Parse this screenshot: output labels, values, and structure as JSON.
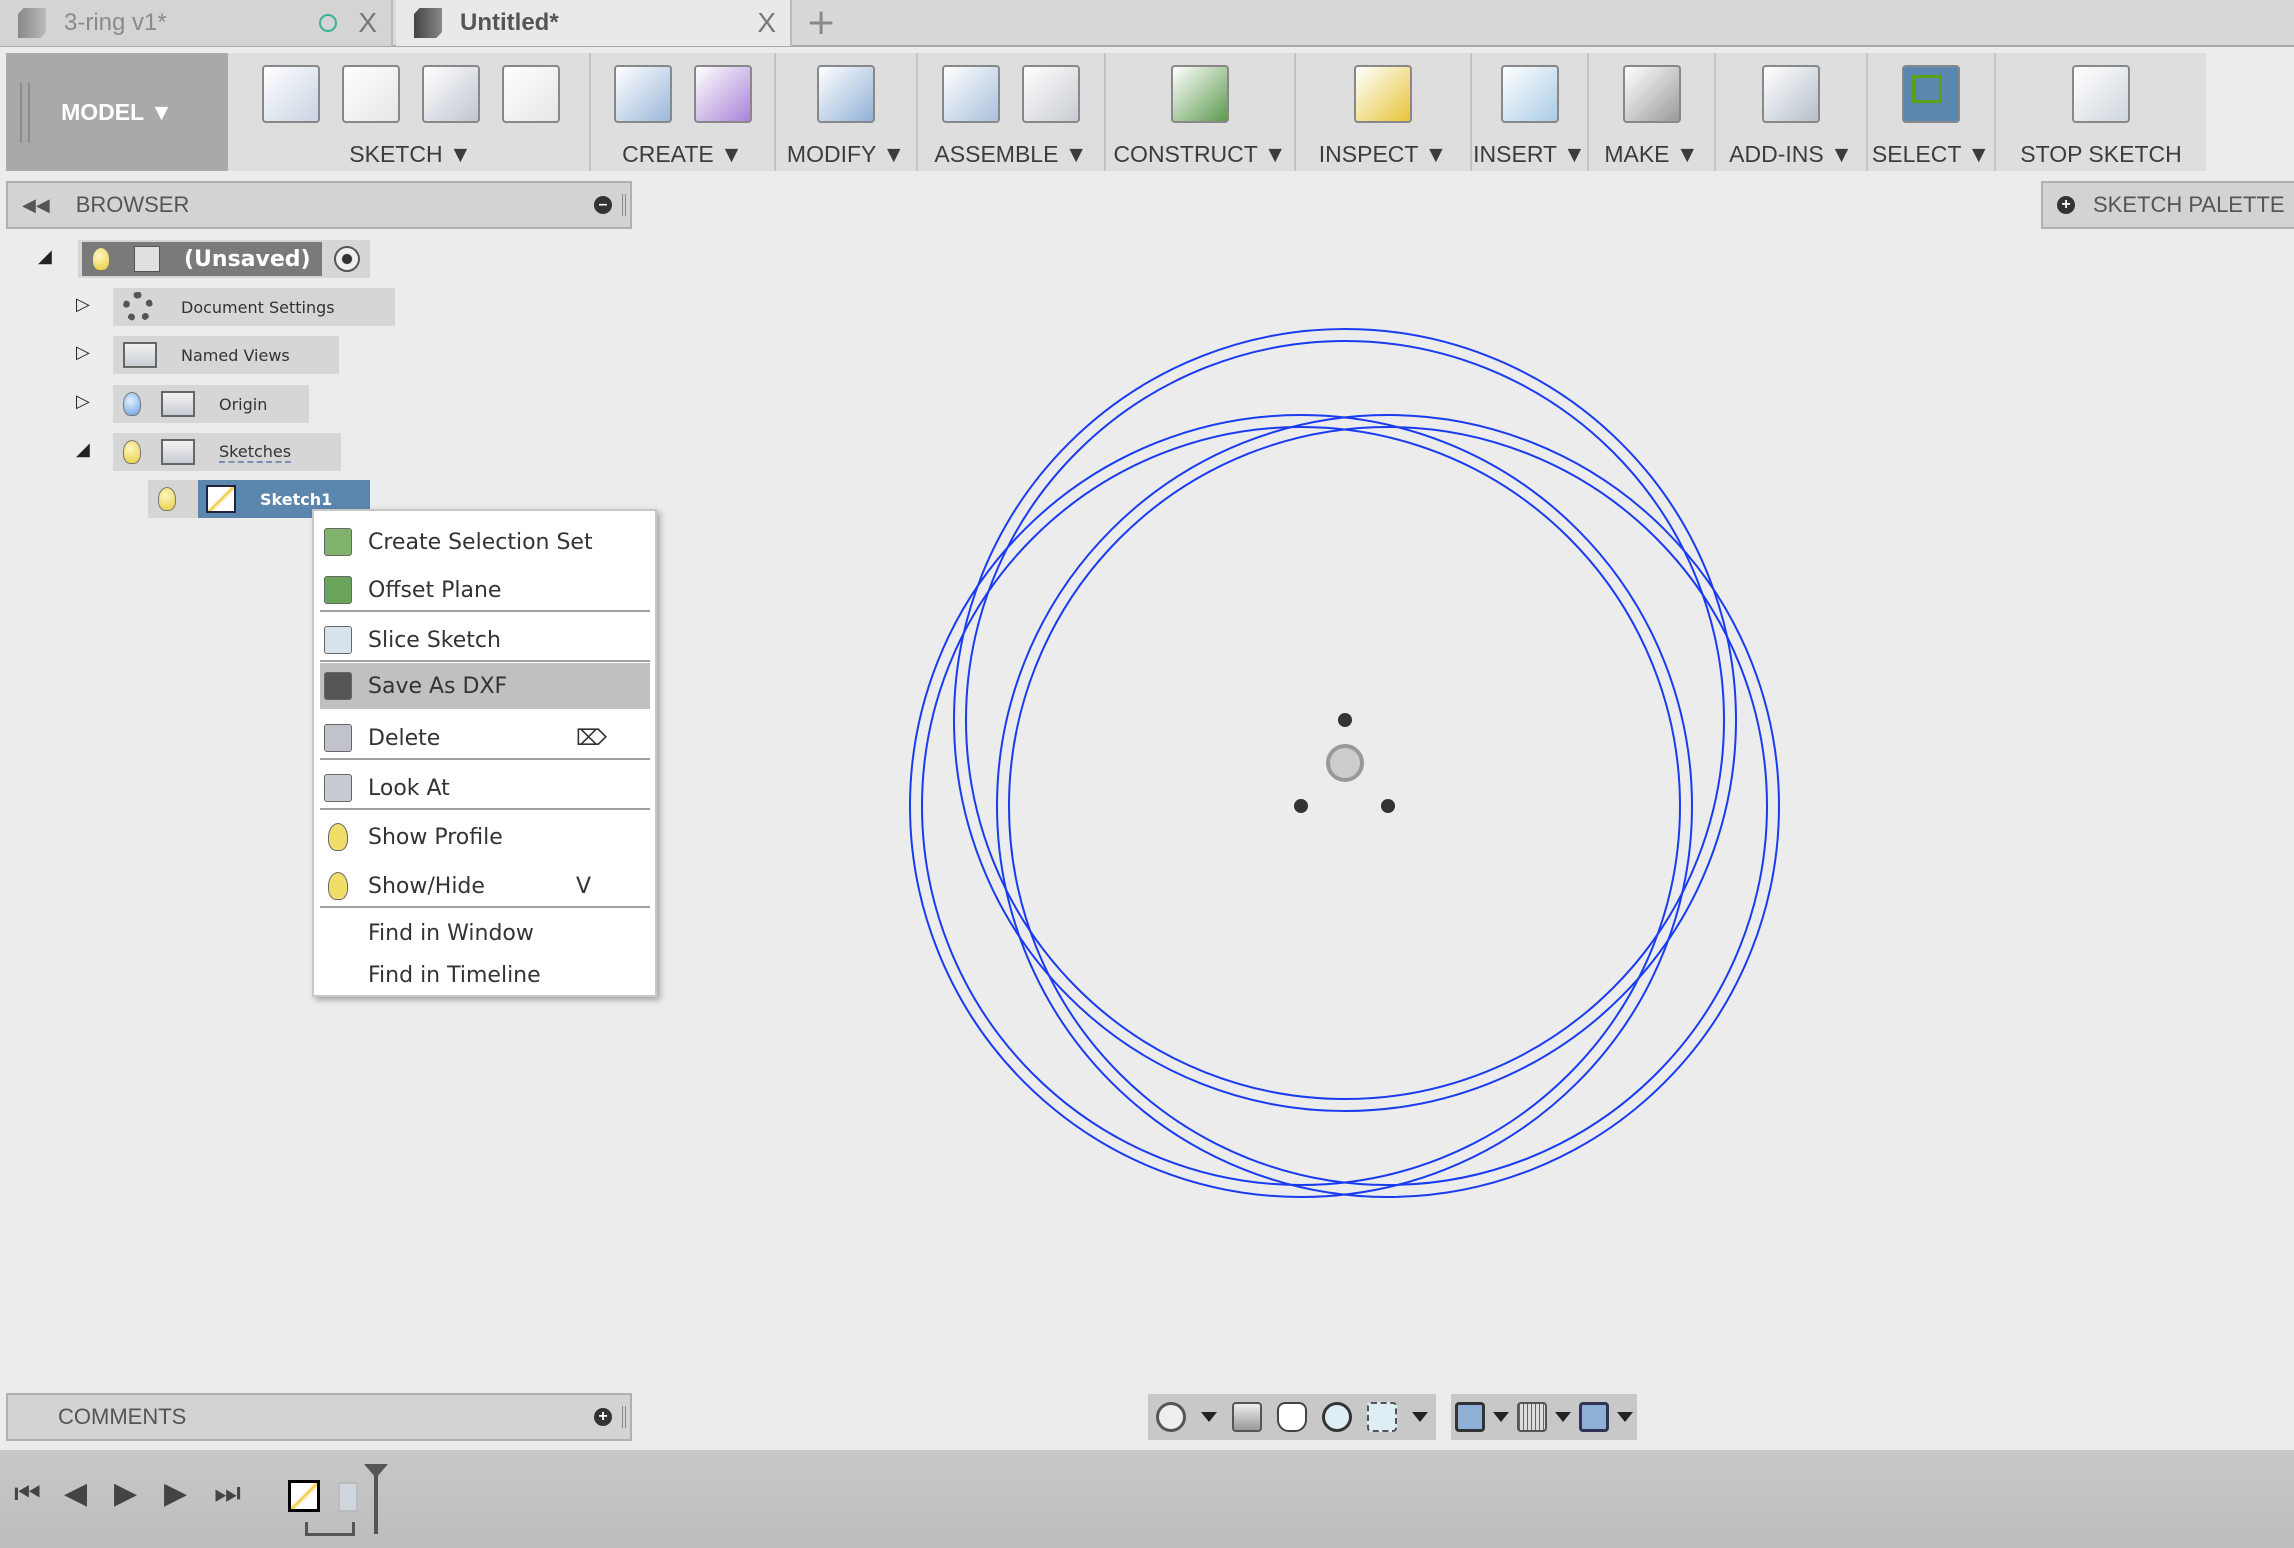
{
  "tabs": [
    {
      "label": "3-ring v1*",
      "close": "X"
    },
    {
      "label": "Untitled*",
      "close": "X"
    }
  ],
  "new_tab": "+",
  "toolbar": {
    "workspace": "MODEL ▼",
    "groups": [
      {
        "label": "SKETCH ▼",
        "icons": [
          "create-sketch-icon",
          "arc-icon",
          "rectangle-icon",
          "spline-icon"
        ],
        "colors": [
          "#c9d3e3",
          "#e6e6e6",
          "#c0c6d0",
          "#e6e6e6"
        ]
      },
      {
        "label": "CREATE ▼",
        "icons": [
          "extrude-icon",
          "form-icon"
        ],
        "colors": [
          "#9ab7da",
          "#a783d6"
        ]
      },
      {
        "label": "MODIFY ▼",
        "icons": [
          "press-pull-icon"
        ],
        "colors": [
          "#8fb0d6"
        ]
      },
      {
        "label": "ASSEMBLE ▼",
        "icons": [
          "new-component-icon",
          "joint-icon"
        ],
        "colors": [
          "#a9c0dc",
          "#c8ccd2"
        ]
      },
      {
        "label": "CONSTRUCT ▼",
        "icons": [
          "offset-plane-icon"
        ],
        "colors": [
          "#5c9a4e"
        ]
      },
      {
        "label": "INSPECT ▼",
        "icons": [
          "measure-icon"
        ],
        "colors": [
          "#e8c43a"
        ]
      },
      {
        "label": "INSERT ▼",
        "icons": [
          "insert-image-icon"
        ],
        "colors": [
          "#a9cbe6"
        ]
      },
      {
        "label": "MAKE ▼",
        "icons": [
          "3d-print-icon"
        ],
        "colors": [
          "#9a9a9a"
        ]
      },
      {
        "label": "ADD-INS ▼",
        "icons": [
          "scripts-addins-icon"
        ],
        "colors": [
          "#b6bfca"
        ]
      },
      {
        "label": "SELECT ▼",
        "icons": [
          "select-icon"
        ],
        "colors": [
          "#5b86ad"
        ]
      },
      {
        "label": "STOP SKETCH",
        "icons": [
          "stop-sketch-icon"
        ],
        "colors": [
          "#cfd6dd"
        ]
      }
    ]
  },
  "browser": {
    "title": "BROWSER",
    "items": [
      {
        "label": "(Unsaved)"
      },
      {
        "label": "Document Settings"
      },
      {
        "label": "Named Views"
      },
      {
        "label": "Origin"
      },
      {
        "label": "Sketches"
      },
      {
        "label": "Sketch1"
      }
    ]
  },
  "sketch_palette": "SKETCH PALETTE",
  "context_menu": {
    "items": [
      {
        "label": "Create Selection Set",
        "icon": "selection-set-icon",
        "color": "#7fb26a"
      },
      {
        "label": "Offset Plane",
        "icon": "offset-plane-icon",
        "color": "#6aa35a"
      },
      {
        "label": "Slice Sketch",
        "icon": "slice-icon",
        "color": "#d7e2ef"
      },
      {
        "label": "Save As DXF",
        "icon": "dxf-icon",
        "color": "#555555",
        "highlighted": true
      },
      {
        "label": "Delete",
        "icon": "delete-icon",
        "color": "#c0c4ca",
        "shortcut": "⌦"
      },
      {
        "label": "Look At",
        "icon": "look-at-icon",
        "color": "#c8ccd2"
      },
      {
        "label": "Show Profile",
        "icon": "bulb-icon",
        "color": "#f0dd6a"
      },
      {
        "label": "Show/Hide",
        "icon": "bulb-icon",
        "color": "#f0dd6a",
        "shortcut": "V"
      },
      {
        "label": "Find in Window"
      },
      {
        "label": "Find in Timeline"
      }
    ]
  },
  "comments": {
    "title": "COMMENTS"
  },
  "timeline": {
    "buttons": [
      "⏮",
      "◀",
      "▶",
      "▶",
      "⏭"
    ]
  },
  "sketch_color": "#1a3cf0",
  "accent": "#5b86ad"
}
